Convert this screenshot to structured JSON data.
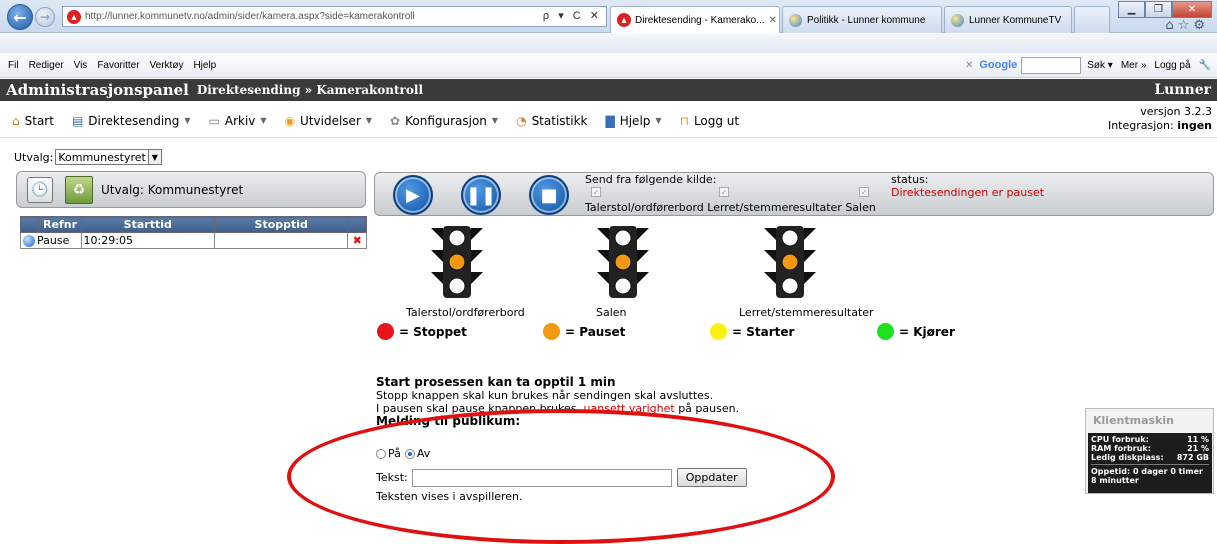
{
  "browser": {
    "url": "http://lunner.kommunetv.no/admin/sider/kamera.aspx?side=kamerakontroll",
    "addr_tools": "ρ ▾ C ✕",
    "tabs": [
      {
        "label": "Direktesending - Kamerako...",
        "active": true
      },
      {
        "label": "Politikk - Lunner kommune",
        "active": false
      },
      {
        "label": "Lunner KommuneTV",
        "active": false
      }
    ],
    "menu": [
      "Fil",
      "Rediger",
      "Vis",
      "Favoritter",
      "Verktøy",
      "Hjelp"
    ],
    "google_logo": "Google",
    "search_label": "Søk ▾",
    "more_label": "Mer »",
    "login_label": "Logg på"
  },
  "app": {
    "title": "Administrasjonspanel",
    "breadcrumb": "Direktesending » Kamerakontroll",
    "org": "Lunner",
    "menu": [
      {
        "label": "Start",
        "icon": "home-icon",
        "glyph": "⌂",
        "dropdown": false
      },
      {
        "label": "Direktesending",
        "icon": "broadcast-icon",
        "glyph": "▤",
        "dropdown": true
      },
      {
        "label": "Arkiv",
        "icon": "archive-icon",
        "glyph": "▭",
        "dropdown": true
      },
      {
        "label": "Utvidelser",
        "icon": "extensions-icon",
        "glyph": "◉",
        "dropdown": true
      },
      {
        "label": "Konfigurasjon",
        "icon": "gear-icon",
        "glyph": "✿",
        "dropdown": true
      },
      {
        "label": "Statistikk",
        "icon": "statistics-icon",
        "glyph": "◔",
        "dropdown": false
      },
      {
        "label": "Hjelp",
        "icon": "help-icon",
        "glyph": "▇",
        "dropdown": true
      },
      {
        "label": "Logg ut",
        "icon": "logout-icon",
        "glyph": "⊓",
        "dropdown": false
      }
    ],
    "version": "versjon 3.2.3",
    "integration_label": "Integrasjon:",
    "integration_value": "ingen"
  },
  "filter": {
    "label": "Utvalg:",
    "value": "Kommunestyret"
  },
  "left_panel": {
    "selection_label": "Utvalg: Kommunestyret"
  },
  "table": {
    "headers": [
      "Refnr",
      "Starttid",
      "Stopptid"
    ],
    "rows": [
      {
        "refnr": "Pause",
        "start": "10:29:05",
        "stop": ""
      }
    ]
  },
  "controls": {
    "source_heading": "Send fra følgende kilde:",
    "sources_text": "Talerstol/ordførerbord Lerret/stemmeresultater Salen",
    "status_label": "status:",
    "status_value": "Direktesendingen er pauset",
    "status_color": "#d00000"
  },
  "lights": [
    {
      "label": "Talerstol/ordførerbord",
      "state": "paused"
    },
    {
      "label": "Salen",
      "state": "paused"
    },
    {
      "label": "Lerret/stemmeresultater",
      "state": "paused"
    }
  ],
  "legend": [
    {
      "label": "= Stoppet",
      "color": "#e8141b"
    },
    {
      "label": "= Pauset",
      "color": "#f39a12"
    },
    {
      "label": "= Starter",
      "color": "#f7f20f"
    },
    {
      "label": "= Kjører",
      "color": "#1ee01e"
    }
  ],
  "info": {
    "heading": "Start prosessen kan ta opptil 1 min",
    "line1": "Stopp knappen skal kun brukes når sendingen skal avsluttes.",
    "line2_a": "I pausen skal pause knappen brukes,",
    "line2_red": "uansett varighet",
    "line2_b": "på pausen.",
    "message_heading": "Melding til publikum:",
    "radio_on": "På",
    "radio_off": "Av",
    "text_label": "Tekst:",
    "text_value": "",
    "update_button": "Oppdater",
    "note": "Teksten vises i avspilleren."
  },
  "client_widget": {
    "title": "Klientmaskin",
    "rows": [
      {
        "label": "CPU forbruk:",
        "value": "11 %"
      },
      {
        "label": "RAM forbruk:",
        "value": "21 %"
      },
      {
        "label": "Ledig diskplass:",
        "value": "872 GB"
      }
    ],
    "uptime": "Oppetid: 0 dager 0 timer 8 minutter"
  }
}
